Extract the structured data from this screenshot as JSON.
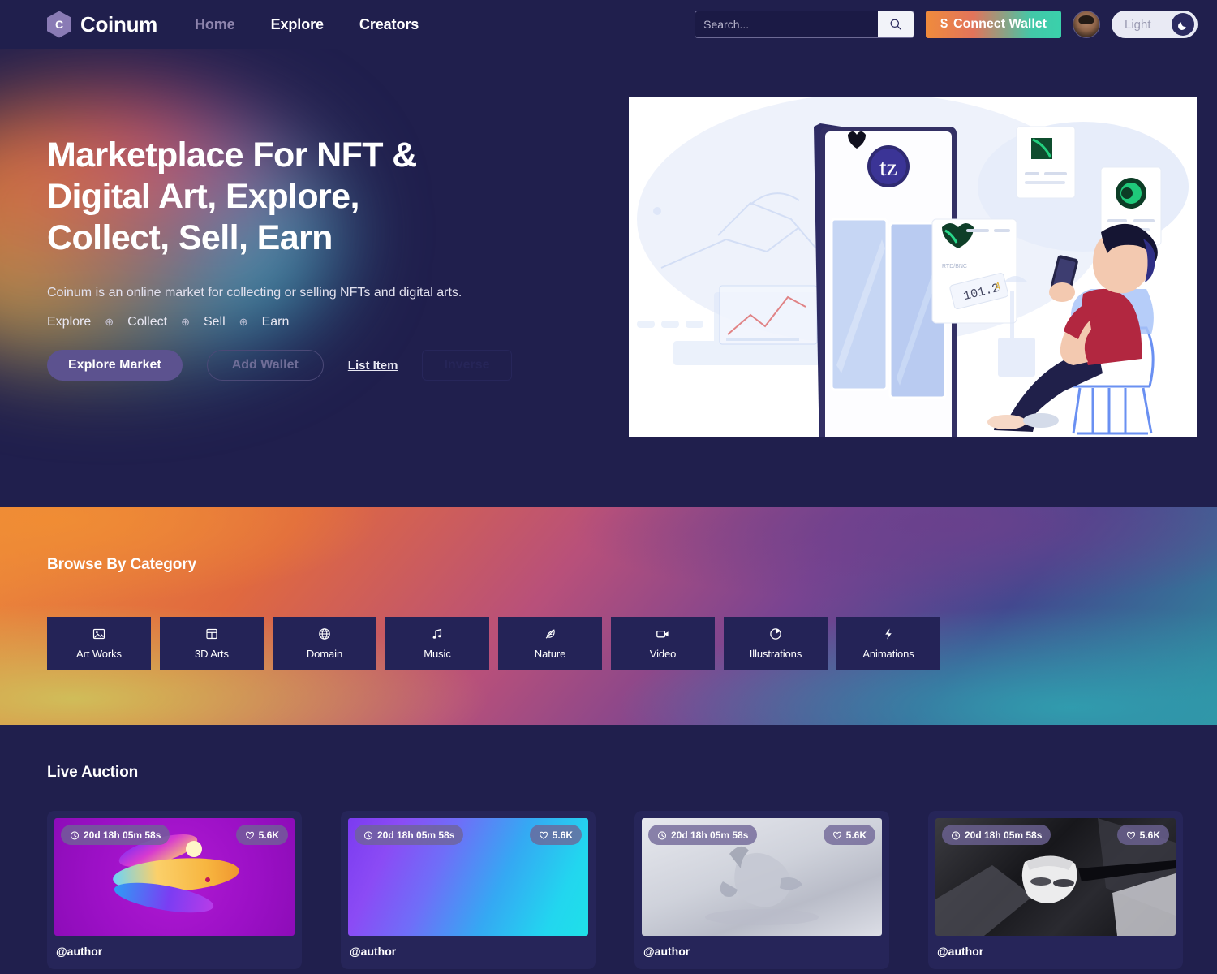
{
  "header": {
    "brand": {
      "mark_letter": "C",
      "name": "Coinum"
    },
    "nav": [
      {
        "label": "Home",
        "active": true
      },
      {
        "label": "Explore",
        "active": false
      },
      {
        "label": "Creators",
        "active": false
      }
    ],
    "search": {
      "placeholder": "Search...",
      "value": "",
      "icon": "search-icon"
    },
    "wallet_button": {
      "label": "Connect Wallet",
      "icon": "dollar-icon"
    },
    "avatar": {
      "alt": "user-avatar"
    },
    "theme_toggle": {
      "label": "Light",
      "icon": "moon-icon"
    }
  },
  "hero": {
    "title": "Marketplace For NFT &\nDigital Art, Explore,\nCollect, Sell, Earn",
    "subtitle": "Coinum is an online market for collecting or selling NFTs and digital arts.",
    "pills": [
      "Explore",
      "Collect",
      "Sell",
      "Earn"
    ],
    "separator": "⊕",
    "actions": {
      "primary": "Explore Market",
      "outline": "Add Wallet",
      "link": "List Item",
      "ghost": "Inverse"
    }
  },
  "categories": {
    "title": "Browse By Category",
    "items": [
      {
        "label": "Art Works",
        "icon": "image-icon"
      },
      {
        "label": "3D Arts",
        "icon": "layout-icon"
      },
      {
        "label": "Domain",
        "icon": "globe-icon"
      },
      {
        "label": "Music",
        "icon": "music-note-icon"
      },
      {
        "label": "Nature",
        "icon": "feather-icon"
      },
      {
        "label": "Video",
        "icon": "video-camera-icon"
      },
      {
        "label": "Illustrations",
        "icon": "pie-chart-icon"
      },
      {
        "label": "Animations",
        "icon": "lightning-bolt-icon"
      }
    ]
  },
  "auction": {
    "title": "Live Auction",
    "cards": [
      {
        "timer": "20d 18h 05m 58s",
        "likes": "5.6K",
        "author": "@author",
        "art": "art-1"
      },
      {
        "timer": "20d 18h 05m 58s",
        "likes": "5.6K",
        "author": "@author",
        "art": "art-2"
      },
      {
        "timer": "20d 18h 05m 58s",
        "likes": "5.6K",
        "author": "@author",
        "art": "art-3"
      },
      {
        "timer": "20d 18h 05m 58s",
        "likes": "5.6K",
        "author": "@author",
        "art": "art-4"
      }
    ],
    "timer_icon": "clock-icon",
    "likes_icon": "heart-icon"
  },
  "colors": {
    "page_bg": "#201f4d",
    "card_bg": "#262559",
    "category_card_bg": "#242357",
    "brand_purple": "#8a7bb5",
    "primary_button": "#5c528f",
    "wallet_gradient_start": "#ef8b3c",
    "wallet_gradient_end": "#3ad1ab",
    "nav_active": "#8e84ad"
  }
}
